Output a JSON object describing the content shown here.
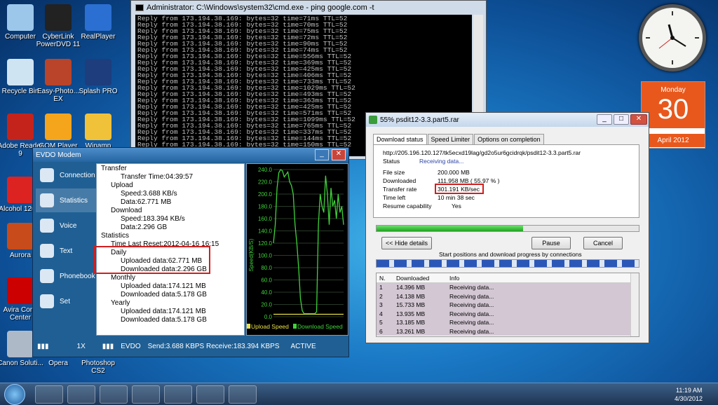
{
  "desktop_icons": [
    {
      "label": "Computer",
      "icon": "computer-icon",
      "color": "#9cc7ea"
    },
    {
      "label": "CyberLink PowerDVD 11",
      "icon": "powerdvd-icon",
      "color": "#222"
    },
    {
      "label": "RealPlayer",
      "icon": "realplayer-icon",
      "color": "#2a6fd1"
    },
    {
      "label": "Recycle Bin",
      "icon": "recycle-bin-icon",
      "color": "#cfe4f2"
    },
    {
      "label": "Easy-Photo... EX",
      "icon": "easy-photo-icon",
      "color": "#b9442a"
    },
    {
      "label": "Splash PRO",
      "icon": "splash-pro-icon",
      "color": "#1d3d7c"
    },
    {
      "label": "Adobe Reader 9",
      "icon": "adobe-reader-icon",
      "color": "#c4231b"
    },
    {
      "label": "GOM Player",
      "icon": "gom-player-icon",
      "color": "#f4a51c"
    },
    {
      "label": "Winamp",
      "icon": "winamp-icon",
      "color": "#f0c23a"
    },
    {
      "label": "Alcohol 120%",
      "icon": "alcohol-icon",
      "color": "#d22"
    },
    {
      "label": "Aurora",
      "icon": "aurora-icon",
      "color": "#c84b1b"
    },
    {
      "label": "Avira Conti Center",
      "icon": "avira-icon",
      "color": "#c00"
    },
    {
      "label": "Canon Soluti...",
      "icon": "canon-icon",
      "color": "#aeb9c8"
    },
    {
      "label": "Opera",
      "icon": "opera-icon",
      "color": "#c00"
    },
    {
      "label": "Photoshop CS2",
      "icon": "photoshop-icon",
      "color": "#4c73b0"
    }
  ],
  "calendar": {
    "day": "Monday",
    "date": "30",
    "month_year": "April 2012"
  },
  "cmd": {
    "title": "Administrator: C:\\Windows\\system32\\cmd.exe - ping  google.com -t",
    "lines": [
      "Reply from 173.194.38.169: bytes=32 time=71ms TTL=52",
      "Reply from 173.194.38.169: bytes=32 time=70ms TTL=52",
      "Reply from 173.194.38.169: bytes=32 time=75ms TTL=52",
      "Reply from 173.194.38.169: bytes=32 time=72ms TTL=52",
      "Reply from 173.194.38.169: bytes=32 time=90ms TTL=52",
      "Reply from 173.194.38.169: bytes=32 time=74ms TTL=52",
      "Reply from 173.194.38.169: bytes=32 time=556ms TTL=52",
      "Reply from 173.194.38.169: bytes=32 time=369ms TTL=52",
      "Reply from 173.194.38.169: bytes=32 time=425ms TTL=52",
      "Reply from 173.194.38.169: bytes=32 time=406ms TTL=52",
      "Reply from 173.194.38.169: bytes=32 time=733ms TTL=52",
      "Reply from 173.194.38.169: bytes=32 time=1029ms TTL=52",
      "Reply from 173.194.38.169: bytes=32 time=493ms TTL=52",
      "Reply from 173.194.38.169: bytes=32 time=363ms TTL=52",
      "Reply from 173.194.38.169: bytes=32 time=425ms TTL=52",
      "Reply from 173.194.38.169: bytes=32 time=571ms TTL=52",
      "Reply from 173.194.38.169: bytes=32 time=1099ms TTL=52",
      "Reply from 173.194.38.169: bytes=32 time=765ms TTL=52",
      "Reply from 173.194.38.169: bytes=32 time=337ms TTL=52",
      "Reply from 173.194.38.169: bytes=32 time=144ms TTL=52",
      "Reply from 173.194.38.169: bytes=32 time=150ms TTL=52",
      "Reply from 173.194.38.169: bytes=32 time=90ms TTL=52"
    ]
  },
  "evdo": {
    "title": "EVDO Modem",
    "nav": [
      "Connection",
      "Statistics",
      "Voice",
      "Text",
      "Phonebook",
      "Set"
    ],
    "tree": [
      "Transfer",
      "Transfer Time:04:39:57",
      "Upload",
      "Speed:3.688 KB/s",
      "Data:62.771 MB",
      "Download",
      "Speed:183.394 KB/s",
      "Data:2.296 GB",
      "Statistics",
      "Time Last Reset:2012-04-16 16:15",
      "Daily",
      "Uploaded data:62.771 MB",
      "Downloaded data:2.296 GB",
      "Monthly",
      "Uploaded data:174.121 MB",
      "Downloaded data:5.178 GB",
      "Yearly",
      "Uploaded data:174.121 MB",
      "Downloaded data:5.178 GB"
    ],
    "status": {
      "net1": "1X",
      "net2": "EVDO",
      "transfer": "Send:3.688 KBPS Receive:183.394 KBPS",
      "state": "ACTIVE"
    }
  },
  "chart_data": {
    "type": "line",
    "ylabel": "Speed(KB/S)",
    "ylim": [
      0,
      240
    ],
    "yticks": [
      "240.0",
      "220.0",
      "200.0",
      "180.0",
      "160.0",
      "140.0",
      "120.0",
      "100.0",
      "80.0",
      "60.0",
      "40.0",
      "20.0",
      "0.0"
    ],
    "series": [
      {
        "name": "Upload Speed",
        "color": "#e8e04a",
        "values": [
          4,
          4,
          4,
          4,
          4,
          4,
          4,
          4,
          4,
          4,
          4,
          4,
          4,
          4,
          4,
          4,
          4,
          4,
          4,
          4,
          4,
          4,
          4,
          4,
          4,
          4,
          4,
          4,
          4,
          4,
          4,
          4,
          4,
          4,
          4,
          4,
          4,
          4,
          4,
          4
        ]
      },
      {
        "name": "Download Speed",
        "color": "#3fd23a",
        "values": [
          120,
          150,
          210,
          235,
          240,
          238,
          228,
          232,
          236,
          220,
          214,
          200,
          150,
          120,
          80,
          30,
          10,
          5,
          5,
          5,
          5,
          5,
          5,
          5,
          8,
          150,
          200,
          180,
          170,
          230,
          200,
          150,
          210,
          180,
          190,
          160,
          200,
          170,
          180,
          150
        ]
      }
    ]
  },
  "download": {
    "title": "55% psdit12-3.3.part5.rar",
    "tabs": [
      "Download status",
      "Speed Limiter",
      "Options on completion"
    ],
    "url": "http://205.196.120.127/tk5ecxd19lag/gd2o5ur6gcidrqk/psdit12-3.3.part5.rar",
    "status_label": "Status",
    "status_value": "Receiving data...",
    "file_size_label": "File size",
    "file_size": "200.000  MB",
    "downloaded_label": "Downloaded",
    "downloaded": "111.958  MB  ( 55.97 % )",
    "rate_label": "Transfer rate",
    "rate": "301.191  KB/sec",
    "time_left_label": "Time left",
    "time_left": "10 min 38 sec",
    "resume_label": "Resume capability",
    "resume": "Yes",
    "progress": 0.5597,
    "hide_details": "<< Hide details",
    "pause": "Pause",
    "cancel": "Cancel",
    "connections_caption": "Start positions and download progress by connections",
    "table_headers": [
      "N.",
      "Downloaded",
      "Info"
    ],
    "rows": [
      {
        "n": "1",
        "dl": "14.396  MB",
        "info": "Receiving data..."
      },
      {
        "n": "2",
        "dl": "14.138  MB",
        "info": "Receiving data..."
      },
      {
        "n": "3",
        "dl": "15.733  MB",
        "info": "Receiving data..."
      },
      {
        "n": "4",
        "dl": "13.935  MB",
        "info": "Receiving data..."
      },
      {
        "n": "5",
        "dl": "13.185  MB",
        "info": "Receiving data..."
      },
      {
        "n": "6",
        "dl": "13.261  MB",
        "info": "Receiving data..."
      }
    ]
  },
  "taskbar": {
    "time": "11:19 AM",
    "date": "4/30/2012"
  }
}
